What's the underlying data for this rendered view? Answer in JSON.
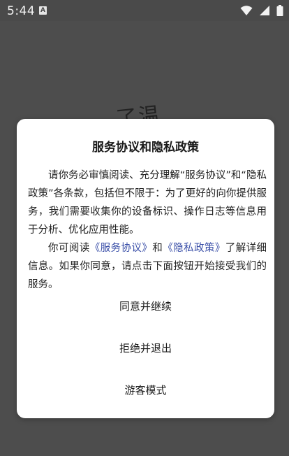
{
  "status_bar": {
    "time": "5:44",
    "notification_glyph": "A",
    "icons": [
      "wifi-icon",
      "signal-icon",
      "battery-icon"
    ]
  },
  "background": {
    "handwriting": "了温"
  },
  "dialog": {
    "title": "服务协议和隐私政策",
    "paragraph1": "请你务必审慎阅读、充分理解“服务协议”和“隐私政策”各条款，包括但不限于：为了更好的向你提供服务，我们需要收集你的设备标识、操作日志等信息用于分析、优化应用性能。",
    "paragraph2_prefix": "你可阅读",
    "link_service": "《服务协议》",
    "paragraph2_and": "和",
    "link_privacy": "《隐私政策》",
    "paragraph2_suffix": "了解详细信息。如果你同意，请点击下面按钮开始接受我们的服务。",
    "buttons": {
      "agree": "同意并继续",
      "reject": "拒绝并退出",
      "guest": "游客模式"
    }
  },
  "colors": {
    "link": "#3a4fa8",
    "scrim": "#4a4a4a",
    "dialog_bg": "#ffffff"
  }
}
